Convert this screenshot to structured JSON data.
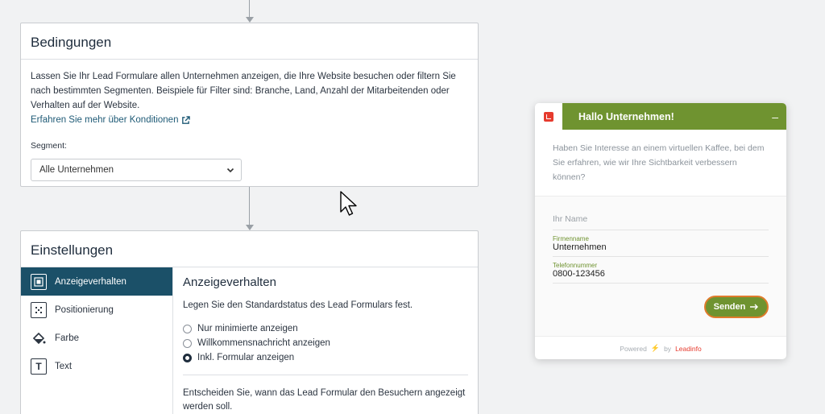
{
  "conditions": {
    "title": "Bedingungen",
    "description": "Lassen Sie Ihr Lead Formulare allen Unternehmen anzeigen, die Ihre Website besuchen oder filtern Sie nach bestimmten Segmenten. Beispiele für Filter sind: Branche, Land, Anzahl der Mitarbeitenden oder Verhalten auf der Website.",
    "link": "Erfahren Sie mehr über Konditionen",
    "segment_label": "Segment:",
    "segment_value": "Alle Unternehmen"
  },
  "settings": {
    "title": "Einstellungen",
    "sidebar": [
      {
        "label": "Anzeigeverhalten",
        "icon": "display-icon"
      },
      {
        "label": "Positionierung",
        "icon": "position-icon"
      },
      {
        "label": "Farbe",
        "icon": "paint-bucket-icon"
      },
      {
        "label": "Text",
        "icon": "text-icon"
      }
    ],
    "content_title": "Anzeigeverhalten",
    "content_desc": "Legen Sie den Standardstatus des Lead Formulars fest.",
    "options": [
      {
        "label": "Nur minimierte anzeigen",
        "checked": false
      },
      {
        "label": "Willkommensnachricht anzeigen",
        "checked": false
      },
      {
        "label": "Inkl. Formular anzeigen",
        "checked": true
      }
    ],
    "content_desc2": "Entscheiden Sie, wann das Lead Formular den Besuchern angezeigt werden soll."
  },
  "widget": {
    "title": "Hallo Unternehmen!",
    "minimize": "–",
    "message": "Haben Sie Interesse an einem virtuellen Kaffee, bei dem Sie erfahren, wie wir Ihre Sichtbarkeit verbessern können?",
    "name_placeholder": "Ihr Name",
    "company_label": "Firmenname",
    "company_value": "Unternehmen",
    "phone_label": "Telefonnummer",
    "phone_value": "0800-123456",
    "send_label": "Senden",
    "footer_powered": "Powered",
    "footer_by": "by",
    "footer_brand": "Leadinfo",
    "accent_color": "#6f9330",
    "brand_color": "#e63b2e"
  }
}
